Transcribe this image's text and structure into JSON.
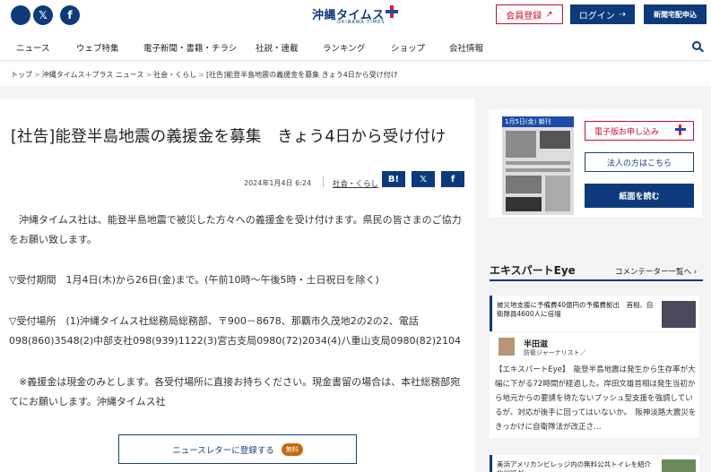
{
  "header": {
    "logo": "沖縄タイムス",
    "logo_plus": "プラス",
    "logo_sub": "OKINAWA TIMES",
    "register_label": "会員登録",
    "login_label": "ログイン",
    "delivery_label": "新聞宅配申込",
    "social_x": "𝕏",
    "social_fb": "f"
  },
  "nav": {
    "items": [
      "ニュース",
      "ウェブ特集",
      "電子新聞・書籍・チラシ",
      "社説・連載",
      "ランキング",
      "ショップ",
      "会社情報"
    ]
  },
  "breadcrumb": {
    "items": [
      "トップ",
      "沖縄タイムス＋プラス ニュース",
      "社会・くらし",
      "[社告]能登半島地震の義援金を募集 きょう4日から受け付け"
    ],
    "separator": ">"
  },
  "article": {
    "title": "[社告]能登半島地震の義援金を募集　きょう4日から受け付け",
    "date": "2024年1月4日 6:24",
    "category": "社会・くらし",
    "share": {
      "hatena": "B!",
      "x": "𝕏",
      "facebook": "f"
    },
    "paragraphs": [
      "　沖縄タイムス社は、能登半島地震で被災した方々への義援金を受け付けます。県民の皆さまのご協力をお願い致します。",
      "▽受付期間　1月4日(木)から26日(金)まで。(午前10時～午後5時・土日祝日を除く)",
      "▽受付場所　(1)沖縄タイムス社総務局総務部、〒900－8678、那覇市久茂地2の2の2、電話098(860)3548(2)中部支社098(939)1122(3)宮古支局0980(72)2034(4)八重山支局0980(82)2104",
      "　※義援金は現金のみとします。各受付場所に直接お持ちください。現金書留の場合は、本社総務部宛てにお願いします。沖縄タイムス社"
    ],
    "newsletter_label": "ニュースレターに登録する",
    "newsletter_badge": "無料"
  },
  "sidebar": {
    "paper_date": "1月5日(金) 朝刊",
    "epaper_label": "電子版お申し込み",
    "corp_label": "法人の方はこちら",
    "read_label": "紙面を読む",
    "expert_title": "エキスパートEye",
    "expert_more": "コメンテーター一覧へ",
    "card1_head": "被災地支援に予備費40億円の予備費拠出　首相、自衛隊員4600人に倍増",
    "expert_name": "半田滋",
    "expert_role": "防衛ジャーナリスト／",
    "expert_body": "【エキスパートEye】　能登半島地震は発生から生存率が大幅に下がる72時間が経過した。岸田文雄首相は発生当初から地元からの要請を待たないプッシュ型支援を強調しているが、対応が後手に回ってはいないか。　阪神淡路大震災をきっかけに自衛隊法が改正さ…",
    "card2_head": "美浜アメリカンビレッジ内の無料公共トイレを紹介　北谷町が"
  }
}
